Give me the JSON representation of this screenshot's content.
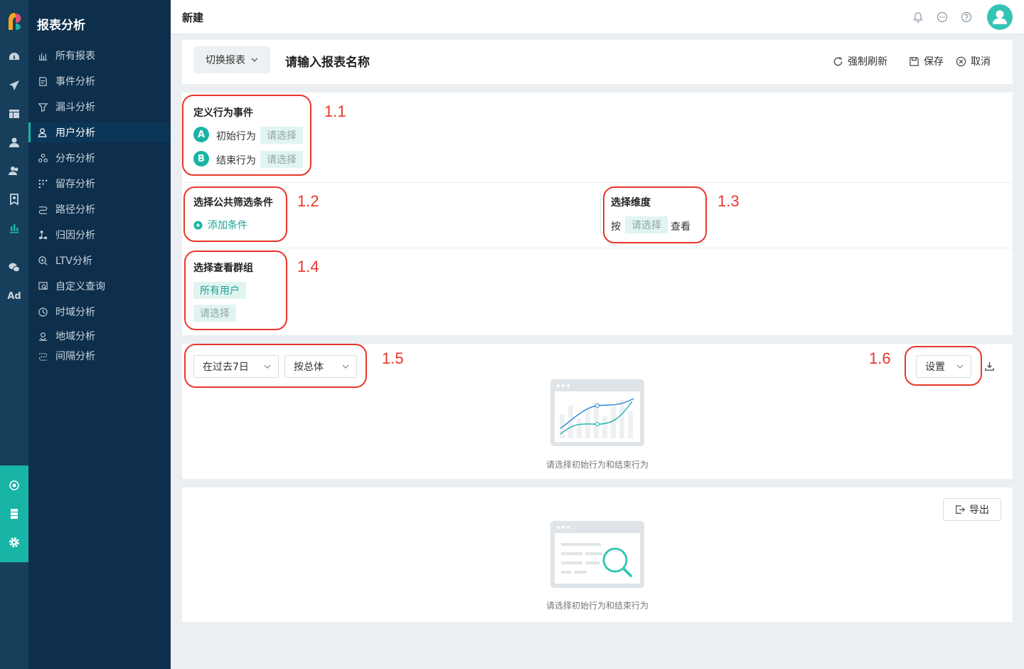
{
  "app": {
    "brand": "报表分析",
    "page_title": "新建"
  },
  "sidebar": {
    "items": [
      {
        "label": "所有报表",
        "icon": "bar-chart-icon"
      },
      {
        "label": "事件分析",
        "icon": "edit-doc-icon"
      },
      {
        "label": "漏斗分析",
        "icon": "funnel-icon"
      },
      {
        "label": "用户分析",
        "icon": "user-icon",
        "active": true
      },
      {
        "label": "分布分析",
        "icon": "distribution-icon"
      },
      {
        "label": "留存分析",
        "icon": "dots-grid-icon"
      },
      {
        "label": "路径分析",
        "icon": "path-icon"
      },
      {
        "label": "归因分析",
        "icon": "attribution-icon"
      },
      {
        "label": "LTV分析",
        "icon": "ltv-icon"
      },
      {
        "label": "自定义查询",
        "icon": "custom-query-icon"
      },
      {
        "label": "时域分析",
        "icon": "clock-icon"
      },
      {
        "label": "地域分析",
        "icon": "location-icon"
      },
      {
        "label": "间隔分析",
        "icon": "interval-icon"
      }
    ]
  },
  "rail": {
    "ad_label": "Ad"
  },
  "toolbar": {
    "switch_label": "切换报表",
    "report_name": "请输入报表名称",
    "refresh_label": "强制刷新",
    "save_label": "保存",
    "cancel_label": "取消"
  },
  "event": {
    "title": "定义行为事件",
    "a_badge": "A",
    "a_label": "初始行为",
    "b_badge": "B",
    "b_label": "结束行为",
    "placeholder": "请选择"
  },
  "filter": {
    "title": "选择公共筛选条件",
    "add_label": "添加条件"
  },
  "dimension": {
    "title": "选择维度",
    "prefix": "按",
    "placeholder": "请选择",
    "suffix": "查看"
  },
  "group": {
    "title": "选择查看群组",
    "all_users": "所有用户",
    "placeholder": "请选择"
  },
  "controls": {
    "date_range": "在过去7日",
    "aggregation": "按总体",
    "settings": "设置"
  },
  "chart_empty": {
    "message": "请选择初始行为和结束行为"
  },
  "table": {
    "export_label": "导出",
    "empty_message": "请选择初始行为和结束行为"
  },
  "annotations": {
    "n11": "1.1",
    "n12": "1.2",
    "n13": "1.3",
    "n14": "1.4",
    "n15": "1.5",
    "n16": "1.6"
  },
  "colors": {
    "accent": "#18b4a6",
    "sidebar": "#0e2f4c",
    "rail": "#173f5b",
    "highlight": "#e8362b"
  }
}
